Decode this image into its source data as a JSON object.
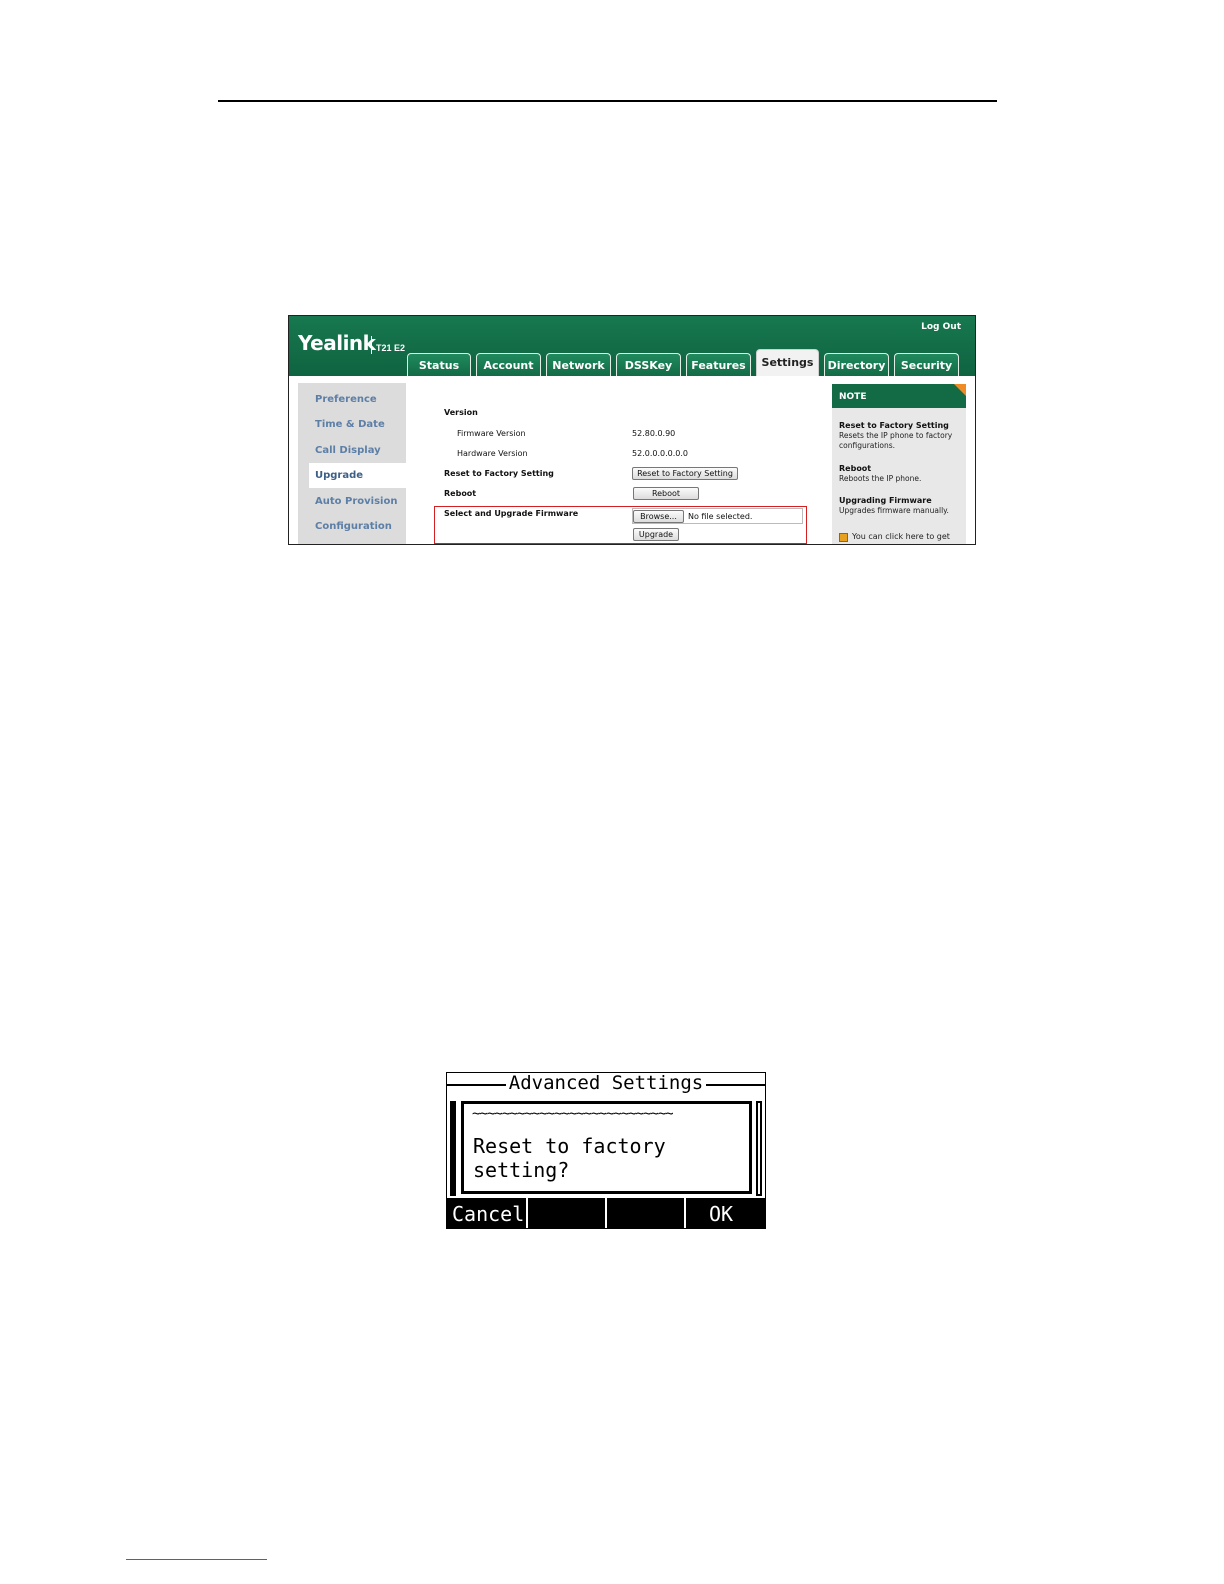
{
  "webui": {
    "logo": "Yealink",
    "model": "T21 E2",
    "logout": "Log Out",
    "tabs": [
      "Status",
      "Account",
      "Network",
      "DSSKey",
      "Features",
      "Settings",
      "Directory",
      "Security"
    ],
    "active_tab": "Settings",
    "sidebar": [
      "Preference",
      "Time & Date",
      "Call Display",
      "Upgrade",
      "Auto Provision",
      "Configuration"
    ],
    "active_sidebar": "Upgrade",
    "content": {
      "version_label": "Version",
      "firmware_label": "Firmware Version",
      "firmware_value": "52.80.0.90",
      "hardware_label": "Hardware Version",
      "hardware_value": "52.0.0.0.0.0.0",
      "reset_label": "Reset to Factory Setting",
      "reset_button": "Reset to Factory Setting",
      "reboot_label": "Reboot",
      "reboot_button": "Reboot",
      "upgrade_label": "Select and Upgrade Firmware",
      "browse_button": "Browse...",
      "no_file": "No file selected.",
      "upgrade_button": "Upgrade"
    },
    "note": {
      "title": "NOTE",
      "items": [
        {
          "title": "Reset to Factory Setting",
          "desc": "Resets the IP phone to factory configurations."
        },
        {
          "title": "Reboot",
          "desc": "Reboots the IP phone."
        },
        {
          "title": "Upgrading Firmware",
          "desc": "Upgrades firmware manually."
        }
      ],
      "link": "You can click here to get"
    },
    "highlight_color": "#d42020",
    "brand_color": "#136b46"
  },
  "phone": {
    "title": "Advanced Settings",
    "wave": "~~~~~~~~~~~~~~~~~~~~~~~~~~~",
    "message": "Reset to factory setting?",
    "softkeys": [
      "Cancel",
      "",
      "",
      "OK"
    ]
  }
}
